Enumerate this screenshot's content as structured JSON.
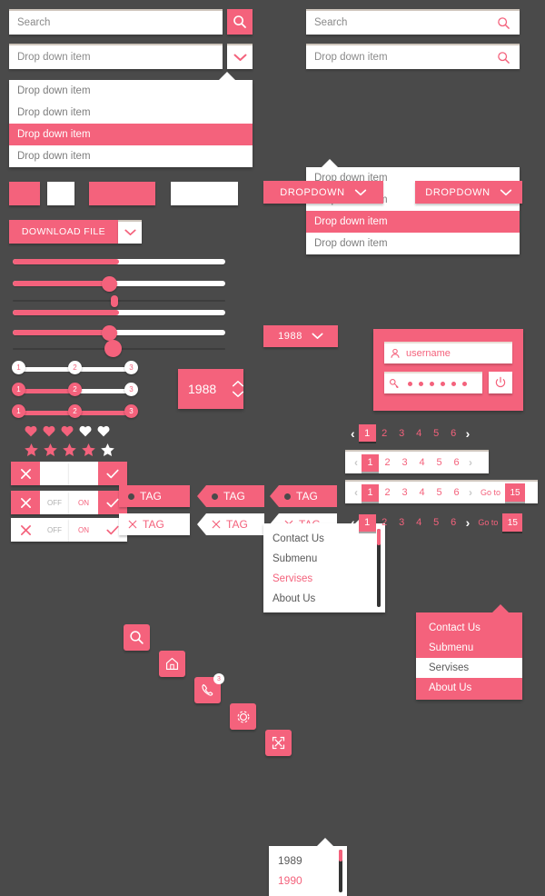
{
  "theme": {
    "accent": "#f4627c",
    "background": "#4a4a4a",
    "surface": "#ffffff",
    "text_muted": "#8a8a8a"
  },
  "search_left": {
    "placeholder": "Search",
    "icon": "search-icon"
  },
  "search_right": {
    "placeholder": "Search",
    "icon": "search-icon"
  },
  "dropdown_left": {
    "value": "Drop down item",
    "icon": "chevron-down-icon"
  },
  "dropdown_right": {
    "value": "Drop down item",
    "icon": "search-icon"
  },
  "dropdown_list_left": {
    "items": [
      {
        "label": "Drop down item",
        "selected": false
      },
      {
        "label": "Drop down item",
        "selected": false
      },
      {
        "label": "Drop down item",
        "selected": true
      },
      {
        "label": "Drop down item",
        "selected": false
      }
    ]
  },
  "dropdown_list_right": {
    "items": [
      {
        "label": "Drop down item",
        "selected": false
      },
      {
        "label": "Drop down item",
        "selected": false
      },
      {
        "label": "Drop down item",
        "selected": true
      },
      {
        "label": "Drop down item",
        "selected": false
      }
    ]
  },
  "download": {
    "label": "DOWNLOAD FILE",
    "caret_icon": "chevron-down-icon"
  },
  "dropdown_button_1": {
    "label": "DROPDOWN",
    "icon": "chevron-down-icon"
  },
  "dropdown_button_2": {
    "label": "DROPDOWN",
    "icon": "chevron-down-icon"
  },
  "menu_white": {
    "items": [
      {
        "label": "Contact Us",
        "active": false
      },
      {
        "label": "Submenu",
        "active": false
      },
      {
        "label": "Servises",
        "active": true
      },
      {
        "label": "About Us",
        "active": false
      }
    ]
  },
  "menu_pink": {
    "items": [
      {
        "label": "Contact Us",
        "active": false
      },
      {
        "label": "Submenu",
        "active": false
      },
      {
        "label": "Servises",
        "active": true
      },
      {
        "label": "About Us",
        "active": false
      }
    ]
  },
  "year_select": {
    "value": "1988",
    "icon": "chevron-down-icon"
  },
  "year_list": {
    "items": [
      {
        "label": "1989",
        "active": false
      },
      {
        "label": "1990",
        "active": true
      }
    ]
  },
  "year_stepper": {
    "value": "1988",
    "up_icon": "chevron-up-icon",
    "down_icon": "chevron-down-icon"
  },
  "sliders": [
    {
      "fill_pct": 50,
      "knob": false,
      "thin": false
    },
    {
      "fill_pct": 47,
      "knob": true,
      "thin": false,
      "knob_size": 16
    },
    {
      "fill_pct": 0,
      "knob": true,
      "thin": true,
      "knob_size": 8
    },
    {
      "fill_pct": 50,
      "knob": false,
      "thin": false
    },
    {
      "fill_pct": 47,
      "knob": true,
      "thin": false,
      "knob_size": 16
    },
    {
      "fill_pct": 0,
      "knob": true,
      "thin": true,
      "knob_size": 18
    }
  ],
  "steps": [
    {
      "labels": [
        "1",
        "2",
        "3"
      ],
      "active_count": 0,
      "fill_pct": 0
    },
    {
      "labels": [
        "1",
        "2",
        "3"
      ],
      "active_count": 2,
      "fill_pct": 50
    },
    {
      "labels": [
        "1",
        "2",
        "3"
      ],
      "active_count": 3,
      "fill_pct": 100
    }
  ],
  "rating_hearts": {
    "icon": "heart-icon",
    "filled": 3,
    "total": 5
  },
  "rating_stars": {
    "icon": "star-icon",
    "filled": 4,
    "total": 5
  },
  "icon_buttons": [
    {
      "name": "search-icon"
    },
    {
      "name": "home-icon"
    },
    {
      "name": "phone-icon",
      "badge": "3"
    },
    {
      "name": "gear-icon"
    },
    {
      "name": "fullscreen-icon"
    }
  ],
  "toggles": [
    {
      "style": "plain",
      "state": "off",
      "left_text": "",
      "right_text": ""
    },
    {
      "style": "plain",
      "state": "on",
      "left_text": "",
      "right_text": ""
    },
    {
      "style": "labeled",
      "state": "off",
      "left_text": "",
      "right_text": "OFF"
    },
    {
      "style": "labeled",
      "state": "on",
      "left_text": "ON",
      "right_text": ""
    },
    {
      "style": "flat",
      "state": "off",
      "left_text": "",
      "right_text": "OFF"
    },
    {
      "style": "flat",
      "state": "on",
      "left_text": "ON",
      "right_text": ""
    }
  ],
  "tags": [
    {
      "label": "TAG",
      "style": "solid",
      "shape": "rect",
      "mark": "dot"
    },
    {
      "label": "TAG",
      "style": "solid",
      "shape": "arrow",
      "mark": "dot"
    },
    {
      "label": "TAG",
      "style": "solid",
      "shape": "arrow",
      "mark": "dot"
    },
    {
      "label": "TAG",
      "style": "hollow",
      "shape": "rect",
      "mark": "x"
    },
    {
      "label": "TAG",
      "style": "hollow",
      "shape": "arrow",
      "mark": "x"
    },
    {
      "label": "TAG",
      "style": "hollow",
      "shape": "arrow",
      "mark": "x"
    }
  ],
  "login": {
    "username": {
      "value": "username",
      "icon": "user-icon"
    },
    "password": {
      "value": "••••••",
      "dots": 6,
      "icon": "key-icon"
    },
    "submit": {
      "icon": "power-icon"
    }
  },
  "pagination": {
    "prev_icon": "chevron-left-icon",
    "next_icon": "chevron-right-icon",
    "pages": [
      "1",
      "2",
      "3",
      "4",
      "5",
      "6"
    ],
    "current": "1",
    "goto_label": "Go to",
    "goto_value": "15",
    "variants": [
      {
        "chrome": "none",
        "goto": false
      },
      {
        "chrome": "bar",
        "goto": false
      },
      {
        "chrome": "bar",
        "goto": true
      },
      {
        "chrome": "none",
        "goto": true
      }
    ]
  }
}
